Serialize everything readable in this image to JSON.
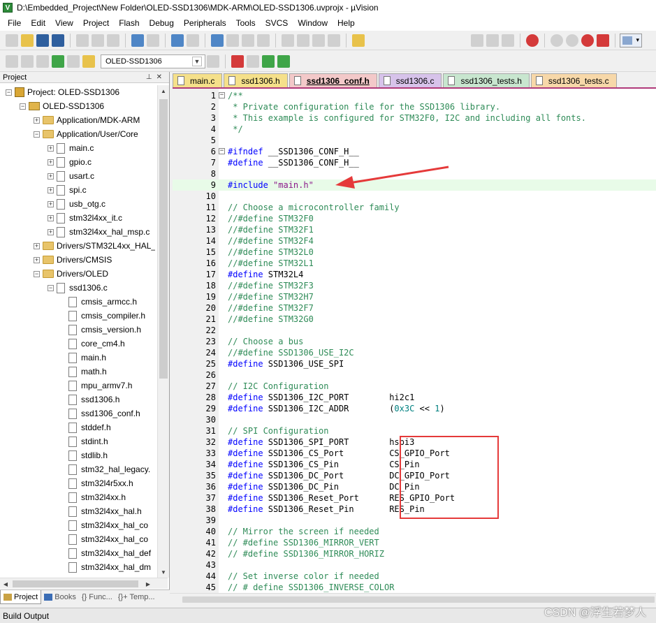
{
  "window": {
    "title": "D:\\Embedded_Project\\New Folder\\OLED-SSD1306\\MDK-ARM\\OLED-SSD1306.uvprojx - µVision"
  },
  "menu": [
    "File",
    "Edit",
    "View",
    "Project",
    "Flash",
    "Debug",
    "Peripherals",
    "Tools",
    "SVCS",
    "Window",
    "Help"
  ],
  "toolbar": {
    "target_name": "OLED-SSD1306"
  },
  "project_panel": {
    "title": "Project",
    "tree": [
      {
        "label": "Project: OLED-SSD1306",
        "level": 0,
        "kind": "project",
        "expander": "−"
      },
      {
        "label": "OLED-SSD1306",
        "level": 1,
        "kind": "target",
        "expander": "−"
      },
      {
        "label": "Application/MDK-ARM",
        "level": 2,
        "kind": "folder",
        "expander": "+"
      },
      {
        "label": "Application/User/Core",
        "level": 2,
        "kind": "folder",
        "expander": "−"
      },
      {
        "label": "main.c",
        "level": 3,
        "kind": "file",
        "expander": "+"
      },
      {
        "label": "gpio.c",
        "level": 3,
        "kind": "file",
        "expander": "+"
      },
      {
        "label": "usart.c",
        "level": 3,
        "kind": "file",
        "expander": "+"
      },
      {
        "label": "spi.c",
        "level": 3,
        "kind": "file",
        "expander": "+"
      },
      {
        "label": "usb_otg.c",
        "level": 3,
        "kind": "file",
        "expander": "+"
      },
      {
        "label": "stm32l4xx_it.c",
        "level": 3,
        "kind": "file",
        "expander": "+"
      },
      {
        "label": "stm32l4xx_hal_msp.c",
        "level": 3,
        "kind": "file",
        "expander": "+"
      },
      {
        "label": "Drivers/STM32L4xx_HAL_",
        "level": 2,
        "kind": "folder",
        "expander": "+"
      },
      {
        "label": "Drivers/CMSIS",
        "level": 2,
        "kind": "folder",
        "expander": "+"
      },
      {
        "label": "Drivers/OLED",
        "level": 2,
        "kind": "folder",
        "expander": "−"
      },
      {
        "label": "ssd1306.c",
        "level": 3,
        "kind": "file",
        "expander": "−"
      },
      {
        "label": "cmsis_armcc.h",
        "level": 4,
        "kind": "file",
        "expander": ""
      },
      {
        "label": "cmsis_compiler.h",
        "level": 4,
        "kind": "file",
        "expander": ""
      },
      {
        "label": "cmsis_version.h",
        "level": 4,
        "kind": "file",
        "expander": ""
      },
      {
        "label": "core_cm4.h",
        "level": 4,
        "kind": "file",
        "expander": ""
      },
      {
        "label": "main.h",
        "level": 4,
        "kind": "file",
        "expander": ""
      },
      {
        "label": "math.h",
        "level": 4,
        "kind": "file",
        "expander": ""
      },
      {
        "label": "mpu_armv7.h",
        "level": 4,
        "kind": "file",
        "expander": ""
      },
      {
        "label": "ssd1306.h",
        "level": 4,
        "kind": "file",
        "expander": ""
      },
      {
        "label": "ssd1306_conf.h",
        "level": 4,
        "kind": "file",
        "expander": ""
      },
      {
        "label": "stddef.h",
        "level": 4,
        "kind": "file",
        "expander": ""
      },
      {
        "label": "stdint.h",
        "level": 4,
        "kind": "file",
        "expander": ""
      },
      {
        "label": "stdlib.h",
        "level": 4,
        "kind": "file",
        "expander": ""
      },
      {
        "label": "stm32_hal_legacy.",
        "level": 4,
        "kind": "file",
        "expander": ""
      },
      {
        "label": "stm32l4r5xx.h",
        "level": 4,
        "kind": "file",
        "expander": ""
      },
      {
        "label": "stm32l4xx.h",
        "level": 4,
        "kind": "file",
        "expander": ""
      },
      {
        "label": "stm32l4xx_hal.h",
        "level": 4,
        "kind": "file",
        "expander": ""
      },
      {
        "label": "stm32l4xx_hal_co",
        "level": 4,
        "kind": "file",
        "expander": ""
      },
      {
        "label": "stm32l4xx_hal_co",
        "level": 4,
        "kind": "file",
        "expander": ""
      },
      {
        "label": "stm32l4xx_hal_def",
        "level": 4,
        "kind": "file",
        "expander": ""
      },
      {
        "label": "stm32l4xx_hal_dm",
        "level": 4,
        "kind": "file",
        "expander": ""
      }
    ],
    "tabs": [
      {
        "label": "Project",
        "active": true
      },
      {
        "label": "Books",
        "active": false
      },
      {
        "label": "{} Func...",
        "active": false
      },
      {
        "label": "{}+ Temp...",
        "active": false
      }
    ]
  },
  "editor": {
    "tabs": [
      {
        "label": "main.c",
        "color": "#f5e08a",
        "active": false
      },
      {
        "label": "ssd1306.h",
        "color": "#f5e08a",
        "active": false
      },
      {
        "label": "ssd1306_conf.h",
        "color": "#f3c9c9",
        "active": true
      },
      {
        "label": "ssd1306.c",
        "color": "#d7c3ea",
        "active": false
      },
      {
        "label": "ssd1306_tests.h",
        "color": "#c8e6cf",
        "active": false
      },
      {
        "label": "ssd1306_tests.c",
        "color": "#f7d8a9",
        "active": false
      }
    ],
    "lines": [
      {
        "n": "1",
        "fold": "−",
        "hl": false,
        "parts": [
          {
            "t": "/**",
            "c": "comment"
          }
        ]
      },
      {
        "n": "2",
        "fold": "",
        "hl": false,
        "parts": [
          {
            "t": " * Private configuration file for the SSD1306 library.",
            "c": "comment"
          }
        ]
      },
      {
        "n": "3",
        "fold": "",
        "hl": false,
        "parts": [
          {
            "t": " * This example is configured for STM32F0, I2C and including all fonts.",
            "c": "comment"
          }
        ]
      },
      {
        "n": "4",
        "fold": "",
        "hl": false,
        "parts": [
          {
            "t": " */",
            "c": "comment"
          }
        ]
      },
      {
        "n": "5",
        "fold": "",
        "hl": false,
        "parts": []
      },
      {
        "n": "6",
        "fold": "−",
        "hl": false,
        "parts": [
          {
            "t": "#ifndef",
            "c": "pre"
          },
          {
            "t": " __SSD1306_CONF_H__",
            "c": "plain"
          }
        ]
      },
      {
        "n": "7",
        "fold": "",
        "hl": false,
        "parts": [
          {
            "t": "#define",
            "c": "pre"
          },
          {
            "t": " __SSD1306_CONF_H__",
            "c": "plain"
          }
        ]
      },
      {
        "n": "8",
        "fold": "",
        "hl": false,
        "parts": []
      },
      {
        "n": "9",
        "fold": "",
        "hl": true,
        "parts": [
          {
            "t": "#include",
            "c": "pre"
          },
          {
            "t": " \"main.h\"",
            "c": "str"
          }
        ]
      },
      {
        "n": "10",
        "fold": "",
        "hl": false,
        "parts": []
      },
      {
        "n": "11",
        "fold": "",
        "hl": false,
        "parts": [
          {
            "t": "// Choose a microcontroller family",
            "c": "comment"
          }
        ]
      },
      {
        "n": "12",
        "fold": "",
        "hl": false,
        "parts": [
          {
            "t": "//#define STM32F0",
            "c": "comment"
          }
        ]
      },
      {
        "n": "13",
        "fold": "",
        "hl": false,
        "parts": [
          {
            "t": "//#define STM32F1",
            "c": "comment"
          }
        ]
      },
      {
        "n": "14",
        "fold": "",
        "hl": false,
        "parts": [
          {
            "t": "//#define STM32F4",
            "c": "comment"
          }
        ]
      },
      {
        "n": "15",
        "fold": "",
        "hl": false,
        "parts": [
          {
            "t": "//#define STM32L0",
            "c": "comment"
          }
        ]
      },
      {
        "n": "16",
        "fold": "",
        "hl": false,
        "parts": [
          {
            "t": "//#define STM32L1",
            "c": "comment"
          }
        ]
      },
      {
        "n": "17",
        "fold": "",
        "hl": false,
        "parts": [
          {
            "t": "#define",
            "c": "pre"
          },
          {
            "t": " STM32L4",
            "c": "plain"
          }
        ]
      },
      {
        "n": "18",
        "fold": "",
        "hl": false,
        "parts": [
          {
            "t": "//#define STM32F3",
            "c": "comment"
          }
        ]
      },
      {
        "n": "19",
        "fold": "",
        "hl": false,
        "parts": [
          {
            "t": "//#define STM32H7",
            "c": "comment"
          }
        ]
      },
      {
        "n": "20",
        "fold": "",
        "hl": false,
        "parts": [
          {
            "t": "//#define STM32F7",
            "c": "comment"
          }
        ]
      },
      {
        "n": "21",
        "fold": "",
        "hl": false,
        "parts": [
          {
            "t": "//#define STM32G0",
            "c": "comment"
          }
        ]
      },
      {
        "n": "22",
        "fold": "",
        "hl": false,
        "parts": []
      },
      {
        "n": "23",
        "fold": "",
        "hl": false,
        "parts": [
          {
            "t": "// Choose a bus",
            "c": "comment"
          }
        ]
      },
      {
        "n": "24",
        "fold": "",
        "hl": false,
        "parts": [
          {
            "t": "//#define SSD1306_USE_I2C",
            "c": "comment"
          }
        ]
      },
      {
        "n": "25",
        "fold": "",
        "hl": false,
        "parts": [
          {
            "t": "#define",
            "c": "pre"
          },
          {
            "t": " SSD1306_USE_SPI",
            "c": "plain"
          }
        ]
      },
      {
        "n": "26",
        "fold": "",
        "hl": false,
        "parts": []
      },
      {
        "n": "27",
        "fold": "",
        "hl": false,
        "parts": [
          {
            "t": "// I2C Configuration",
            "c": "comment"
          }
        ]
      },
      {
        "n": "28",
        "fold": "",
        "hl": false,
        "parts": [
          {
            "t": "#define",
            "c": "pre"
          },
          {
            "t": " SSD1306_I2C_PORT        hi2c1",
            "c": "plain"
          }
        ]
      },
      {
        "n": "29",
        "fold": "",
        "hl": false,
        "parts": [
          {
            "t": "#define",
            "c": "pre"
          },
          {
            "t": " SSD1306_I2C_ADDR        (",
            "c": "plain"
          },
          {
            "t": "0x3C",
            "c": "num"
          },
          {
            "t": " << ",
            "c": "plain"
          },
          {
            "t": "1",
            "c": "num"
          },
          {
            "t": ")",
            "c": "plain"
          }
        ]
      },
      {
        "n": "30",
        "fold": "",
        "hl": false,
        "parts": []
      },
      {
        "n": "31",
        "fold": "",
        "hl": false,
        "parts": [
          {
            "t": "// SPI Configuration",
            "c": "comment"
          }
        ]
      },
      {
        "n": "32",
        "fold": "",
        "hl": false,
        "parts": [
          {
            "t": "#define",
            "c": "pre"
          },
          {
            "t": " SSD1306_SPI_PORT        hspi3",
            "c": "plain"
          }
        ]
      },
      {
        "n": "33",
        "fold": "",
        "hl": false,
        "parts": [
          {
            "t": "#define",
            "c": "pre"
          },
          {
            "t": " SSD1306_CS_Port         CS_GPIO_Port",
            "c": "plain"
          }
        ]
      },
      {
        "n": "34",
        "fold": "",
        "hl": false,
        "parts": [
          {
            "t": "#define",
            "c": "pre"
          },
          {
            "t": " SSD1306_CS_Pin          CS_Pin",
            "c": "plain"
          }
        ]
      },
      {
        "n": "35",
        "fold": "",
        "hl": false,
        "parts": [
          {
            "t": "#define",
            "c": "pre"
          },
          {
            "t": " SSD1306_DC_Port         DC_GPIO_Port",
            "c": "plain"
          }
        ]
      },
      {
        "n": "36",
        "fold": "",
        "hl": false,
        "parts": [
          {
            "t": "#define",
            "c": "pre"
          },
          {
            "t": " SSD1306_DC_Pin          DC_Pin",
            "c": "plain"
          }
        ]
      },
      {
        "n": "37",
        "fold": "",
        "hl": false,
        "parts": [
          {
            "t": "#define",
            "c": "pre"
          },
          {
            "t": " SSD1306_Reset_Port      RES_GPIO_Port",
            "c": "plain"
          }
        ]
      },
      {
        "n": "38",
        "fold": "",
        "hl": false,
        "parts": [
          {
            "t": "#define",
            "c": "pre"
          },
          {
            "t": " SSD1306_Reset_Pin       RES_Pin",
            "c": "plain"
          }
        ]
      },
      {
        "n": "39",
        "fold": "",
        "hl": false,
        "parts": []
      },
      {
        "n": "40",
        "fold": "",
        "hl": false,
        "parts": [
          {
            "t": "// Mirror the screen if needed",
            "c": "comment"
          }
        ]
      },
      {
        "n": "41",
        "fold": "",
        "hl": false,
        "parts": [
          {
            "t": "// #define SSD1306_MIRROR_VERT",
            "c": "comment"
          }
        ]
      },
      {
        "n": "42",
        "fold": "",
        "hl": false,
        "parts": [
          {
            "t": "// #define SSD1306_MIRROR_HORIZ",
            "c": "comment"
          }
        ]
      },
      {
        "n": "43",
        "fold": "",
        "hl": false,
        "parts": []
      },
      {
        "n": "44",
        "fold": "",
        "hl": false,
        "parts": [
          {
            "t": "// Set inverse color if needed",
            "c": "comment"
          }
        ]
      },
      {
        "n": "45",
        "fold": "",
        "hl": false,
        "parts": [
          {
            "t": "// # define SSD1306_INVERSE_COLOR",
            "c": "comment"
          }
        ]
      }
    ]
  },
  "status": {
    "build_output": "Build Output"
  },
  "watermark": "CSDN @浮生若梦人",
  "colors": {
    "annotation": "#e53a3a",
    "active_tab_border": "#b03a7a"
  }
}
